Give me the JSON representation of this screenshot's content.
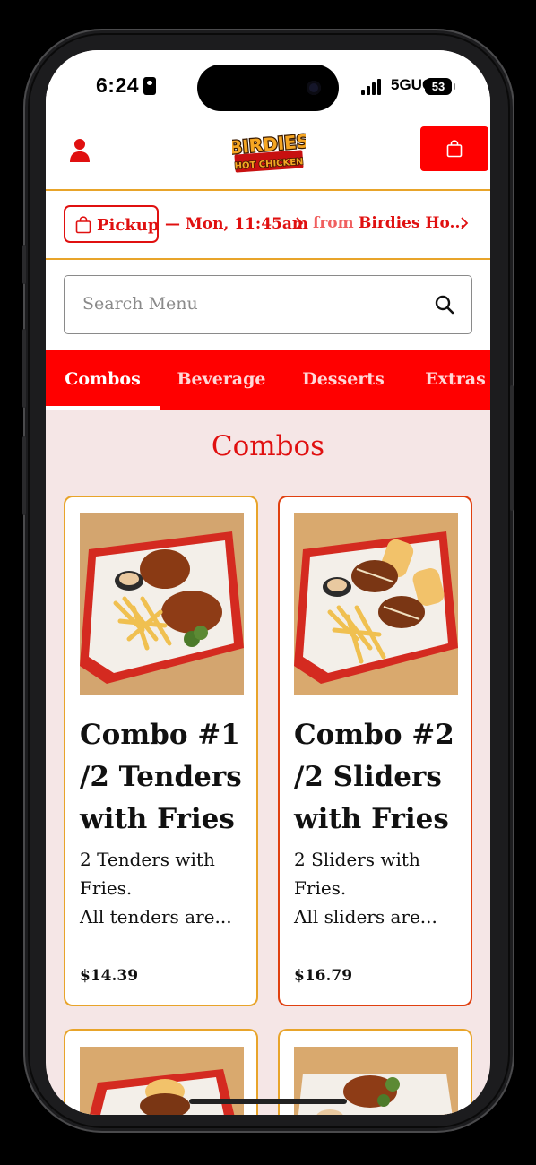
{
  "status_bar": {
    "time": "6:24",
    "network": "5GUC",
    "battery": "53"
  },
  "header": {
    "logo_text_top": "BIRDIES",
    "logo_text_bottom": "HOT CHICKEN",
    "user_icon": "user-icon",
    "cart_icon": "shopping-bag-icon"
  },
  "order_bar": {
    "mode": "Pickup",
    "time": "— Mon, 11:45am",
    "from_label": "from",
    "location": "Birdies Ho..."
  },
  "search": {
    "placeholder": "Search Menu"
  },
  "tabs": [
    {
      "label": "Combos",
      "active": true
    },
    {
      "label": "Beverage",
      "active": false
    },
    {
      "label": "Desserts",
      "active": false
    },
    {
      "label": "Extras",
      "active": false
    }
  ],
  "section": {
    "title": "Combos"
  },
  "items": [
    {
      "name": "Combo #1 /2 Tenders with Fries",
      "desc_line1": "2 Tenders with Fries.",
      "desc_line2": "All tenders are...",
      "price": "$14.39"
    },
    {
      "name": "Combo #2 /2 Sliders with Fries",
      "desc_line1": "2 Sliders with Fries.",
      "desc_line2": "All sliders are...",
      "price": "$16.79"
    }
  ],
  "colors": {
    "brand_red": "#ff0000",
    "accent_gold": "#e8a42a",
    "page_bg": "#f5e6e6"
  }
}
